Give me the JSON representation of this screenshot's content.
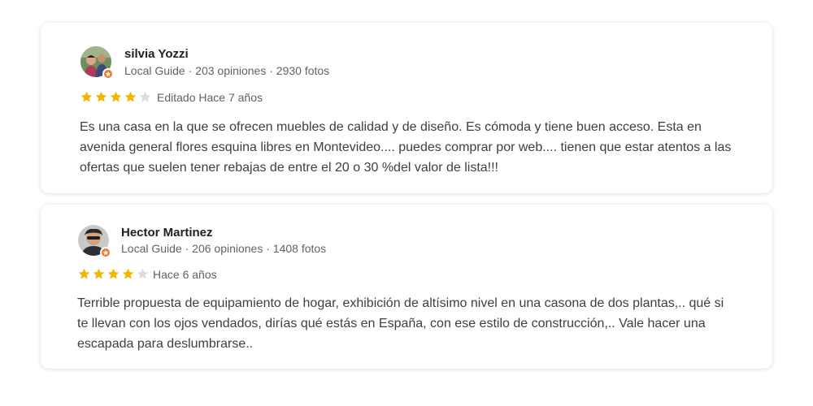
{
  "colors": {
    "star_filled": "#f4b400",
    "star_empty": "#dadce0",
    "badge": "#f2772a",
    "name_text": "#202124",
    "meta_text": "#5f6368",
    "body_text": "#3c4043"
  },
  "reviews": [
    {
      "author": "silvia Yozzi",
      "meta": "Local Guide · 203 opiniones · 2930 fotos",
      "rating": 4,
      "max_rating": 5,
      "time": "Editado Hace 7 años",
      "text": "Es una casa en la que se ofrecen muebles de calidad y de diseño. Es cómoda y tiene buen acceso. Esta en avenida general flores esquina libres en Montevideo.... puedes comprar por web.... tienen que estar atentos a las ofertas que suelen tener rebajas de entre el 20 o 30 %del valor de lista!!!",
      "avatar_icon": "user-avatar-icon",
      "badge_icon": "local-guide-badge-icon"
    },
    {
      "author": "Hector Martinez",
      "meta": "Local Guide · 206 opiniones · 1408 fotos",
      "rating": 4,
      "max_rating": 5,
      "time": "Hace 6 años",
      "text": "Terrible propuesta de equipamiento de hogar, exhibición de altísimo nivel en una casona de dos plantas,.. qué si te llevan con los ojos vendados, dirías qué estás en España, con ese estilo de construcción,.. Vale hacer una escapada para deslumbrarse..",
      "avatar_icon": "user-avatar-icon",
      "badge_icon": "local-guide-badge-icon"
    }
  ]
}
